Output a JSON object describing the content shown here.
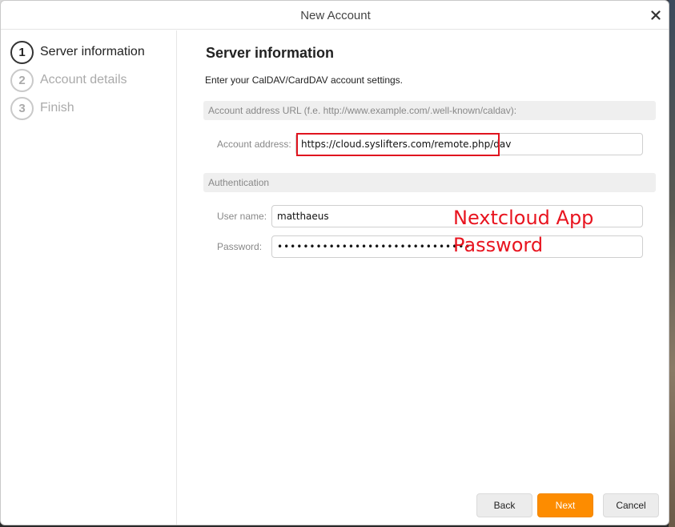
{
  "window": {
    "title": "New Account",
    "close_icon": "close-icon"
  },
  "sidebar": {
    "steps": [
      {
        "number": "1",
        "label": "Server information",
        "active": true
      },
      {
        "number": "2",
        "label": "Account details",
        "active": false
      },
      {
        "number": "3",
        "label": "Finish",
        "active": false
      }
    ]
  },
  "main": {
    "heading": "Server information",
    "subtext": "Enter your CalDAV/CardDAV account settings.",
    "address_section": {
      "title": "Account address URL (f.e. http://www.example.com/.well-known/caldav):",
      "address_label": "Account address:",
      "address_value": "https://cloud.syslifters.com/remote.php/dav"
    },
    "auth_section": {
      "title": "Authentication",
      "username_label": "User name:",
      "username_value": "matthaeus",
      "password_label": "Password:",
      "password_value": "••••••••••••••••••••••••••••••"
    },
    "annotation": {
      "line1": "Nextcloud App",
      "line2": "Password",
      "color": "#e8141f"
    }
  },
  "footer": {
    "back_label": "Back",
    "next_label": "Next",
    "cancel_label": "Cancel"
  },
  "colors": {
    "accent": "#fd8c00",
    "highlight": "#e0141f"
  }
}
